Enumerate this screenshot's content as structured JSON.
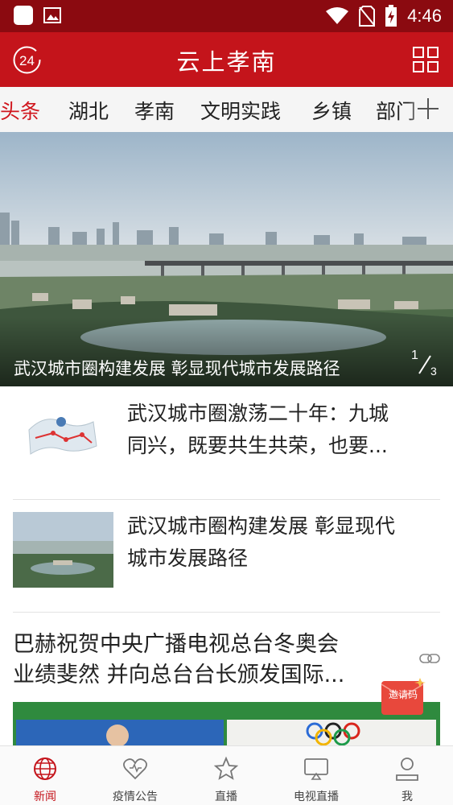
{
  "status_bar": {
    "time": "4:46"
  },
  "header": {
    "title": "云上孝南",
    "logo_text": "24"
  },
  "tabs": [
    {
      "label": "头条",
      "active": true
    },
    {
      "label": "湖北",
      "active": false
    },
    {
      "label": "孝南",
      "active": false
    },
    {
      "label": "文明实践",
      "active": false
    },
    {
      "label": "乡镇",
      "active": false
    },
    {
      "label": "部门",
      "active": false
    }
  ],
  "banner": {
    "caption": "武汉城市圈构建发展 彰显现代城市发展路径",
    "index_current": "1",
    "index_total": "3"
  },
  "news": [
    {
      "title_line1": "武汉城市圈激荡二十年：九城",
      "title_line2": "同兴，既要共生共荣，也要..."
    },
    {
      "title_line1": "武汉城市圈构建发展 彰显现代",
      "title_line2": "城市发展路径"
    }
  ],
  "feature": {
    "title_line1": "巴赫祝贺中央广播电视总台冬奥会",
    "title_line2": "业绩斐然 并向总台台长颁发国际..."
  },
  "invite": {
    "label": "邀请码"
  },
  "bottom_nav": [
    {
      "label": "新闻",
      "icon": "globe-icon",
      "active": true
    },
    {
      "label": "疫情公告",
      "icon": "heart-icon",
      "active": false
    },
    {
      "label": "直播",
      "icon": "star-icon",
      "active": false
    },
    {
      "label": "电视直播",
      "icon": "tv-icon",
      "active": false
    },
    {
      "label": "我",
      "icon": "user-icon",
      "active": false
    }
  ],
  "colors": {
    "brand_red": "#c4141b",
    "status_bar": "#8b0a10",
    "active_tab": "#d0161d"
  }
}
